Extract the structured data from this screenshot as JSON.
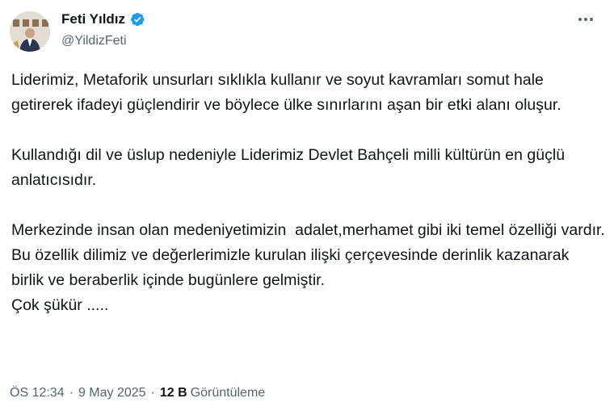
{
  "author": {
    "display_name": "Feti Yıldız",
    "handle": "@YildizFeti"
  },
  "icons": {
    "verified": "verified-badge-icon",
    "more": "more-options-icon"
  },
  "colors": {
    "verified_blue": "#1d9bf0",
    "text_primary": "#0f1419",
    "text_secondary": "#536471"
  },
  "tweet": {
    "paragraphs": [
      "Liderimiz, Metaforik unsurları sıklıkla kullanır ve soyut kavramları somut hale getirerek ifadeyi güçlendirir ve böylece ülke sınırlarını aşan bir etki alanı oluşur.",
      "Kullandığı dil ve üslup nedeniyle Liderimiz Devlet Bahçeli milli kültürün en güçlü anlatıcısıdır.",
      "Merkezinde insan olan medeniyetimizin  adalet,merhamet gibi iki temel özelliği vardır.",
      "Bu özellik dilimiz ve değerlerimizle kurulan ilişki çerçevesinde derinlik kazanarak birlik ve beraberlik içinde bugünlere gelmiştir.",
      "Çok şükür ....."
    ]
  },
  "meta": {
    "time": "ÖS 12:34",
    "date": "9 May 2025",
    "separator": "·",
    "views_count": "12 B",
    "views_label": "Görüntüleme"
  }
}
